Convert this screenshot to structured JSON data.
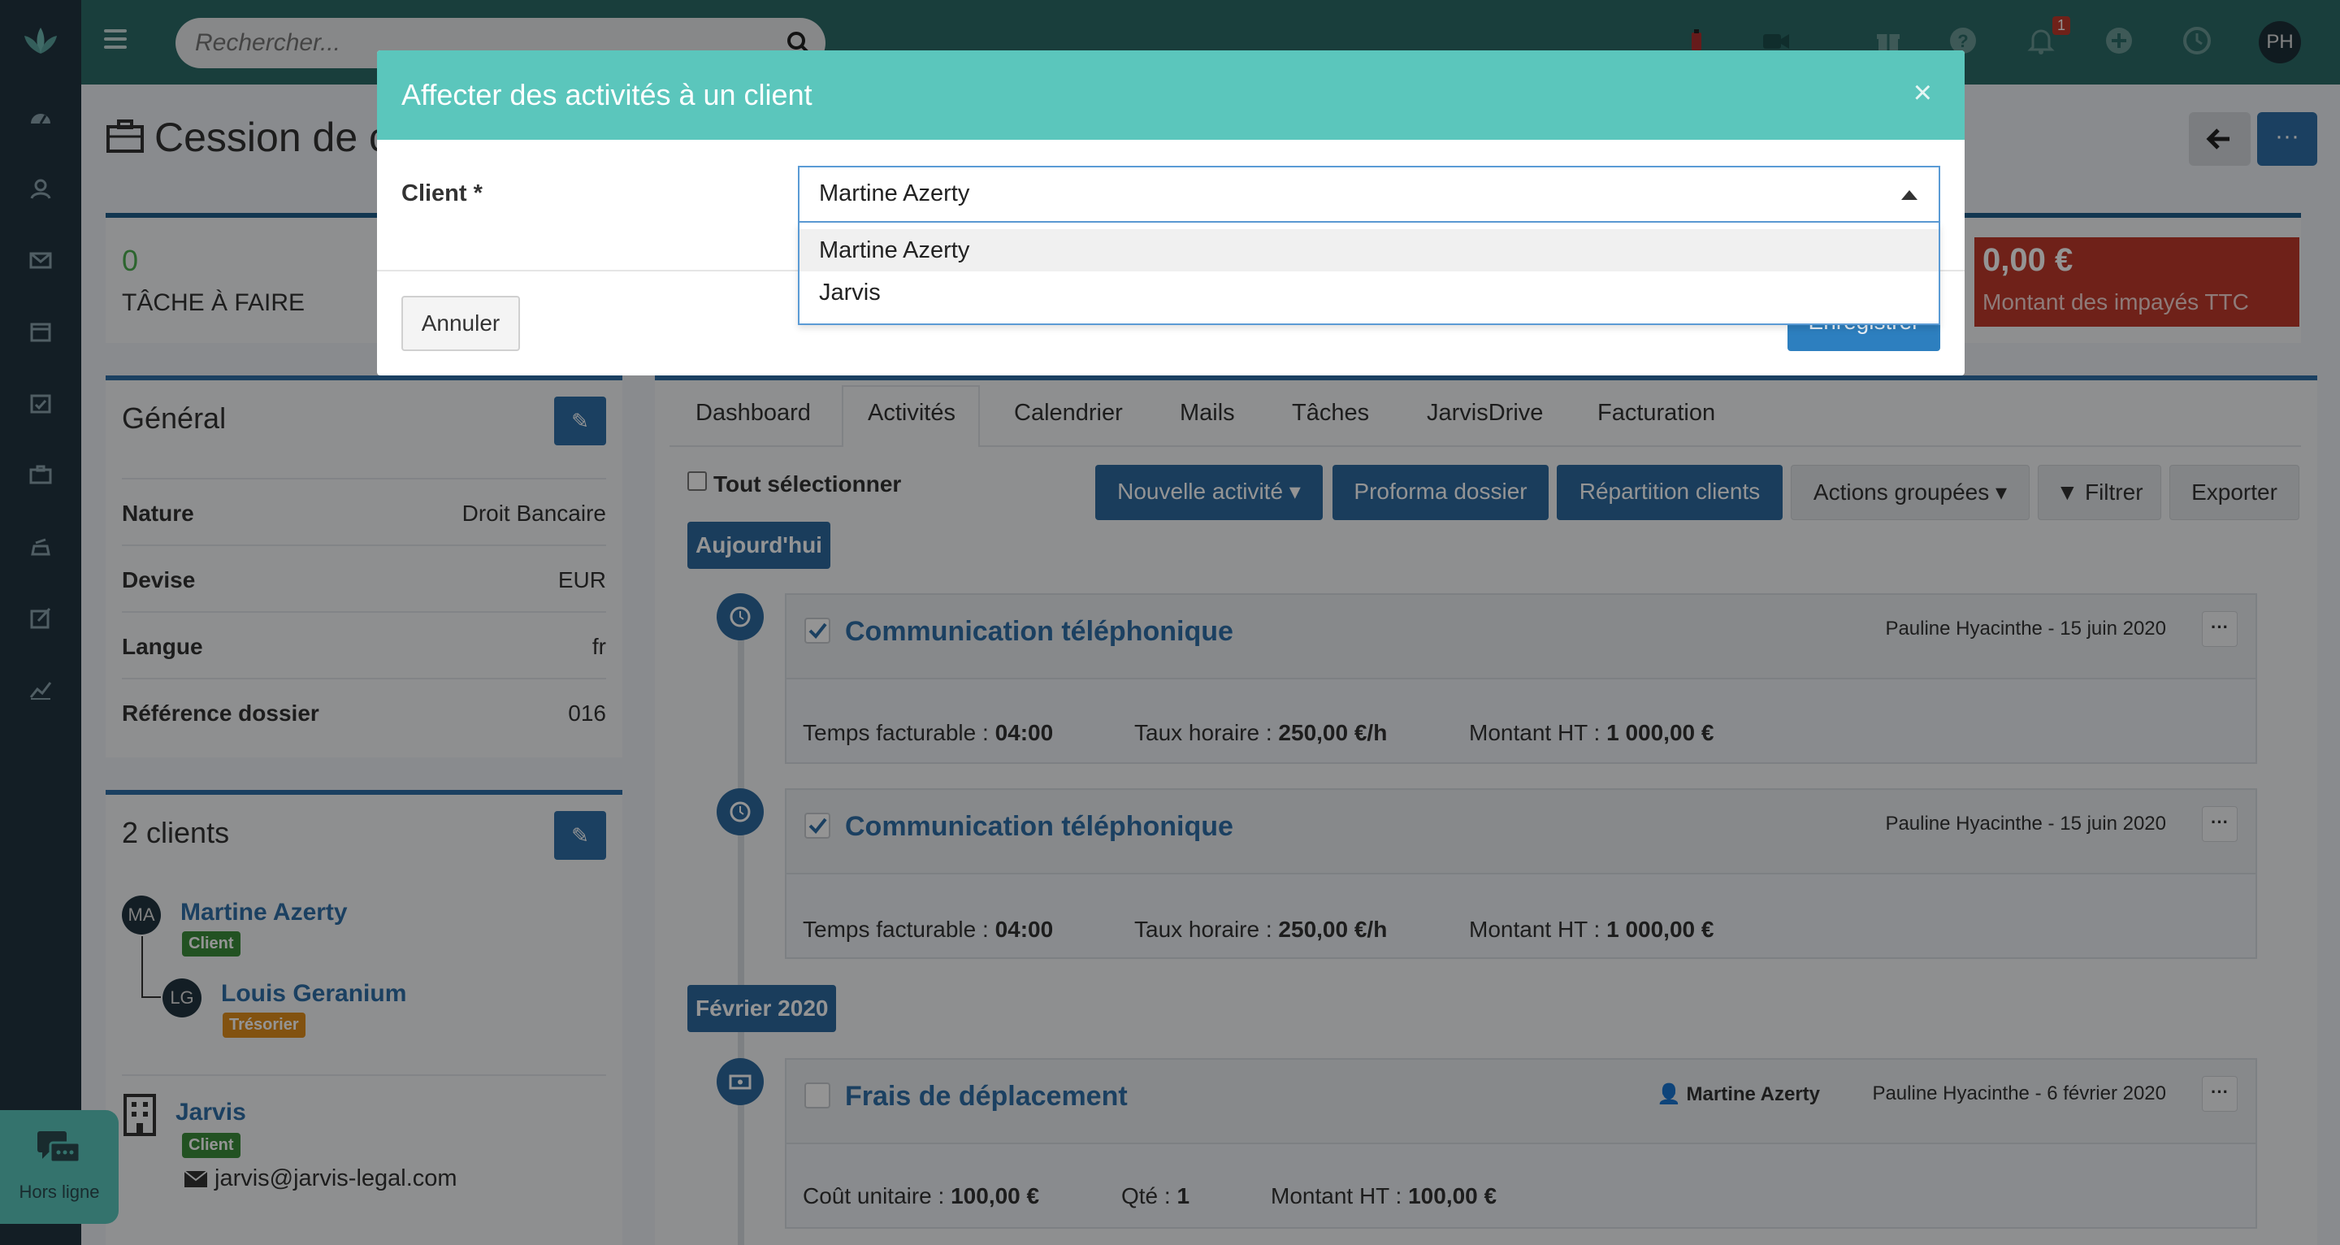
{
  "topbar": {
    "search_placeholder": "Rechercher...",
    "notification_count": "1",
    "user_initials": "PH"
  },
  "page": {
    "title": "Cession de c"
  },
  "kpis": {
    "tasks_value": "0",
    "tasks_label": "TÂCHE À FAIRE",
    "unpaid_value": "0,00 €",
    "unpaid_label": "Montant des impayés TTC"
  },
  "general": {
    "title": "Général",
    "rows": [
      {
        "key": "Nature",
        "value": "Droit Bancaire"
      },
      {
        "key": "Devise",
        "value": "EUR"
      },
      {
        "key": "Langue",
        "value": "fr"
      },
      {
        "key": "Référence dossier",
        "value": "016"
      }
    ]
  },
  "clients": {
    "title": "2 clients",
    "items": [
      {
        "initials": "MA",
        "name": "Martine Azerty",
        "tag": "Client"
      },
      {
        "initials": "LG",
        "name": "Louis Geranium",
        "tag": "Trésorier"
      },
      {
        "name": "Jarvis",
        "tag": "Client",
        "email": "jarvis@jarvis-legal.com"
      }
    ]
  },
  "tabs": [
    "Dashboard",
    "Activités",
    "Calendrier",
    "Mails",
    "Tâches",
    "JarvisDrive",
    "Facturation"
  ],
  "toolbar": {
    "select_all": "Tout sélectionner",
    "new_activity": "Nouvelle activité",
    "proforma": "Proforma dossier",
    "repartition": "Répartition clients",
    "group_actions": "Actions groupées",
    "filter": "Filtrer",
    "export": "Exporter"
  },
  "groups": [
    {
      "label": "Aujourd'hui",
      "activities": [
        {
          "title": "Communication téléphonique",
          "meta": "Pauline Hyacinthe - 15 juin 2020",
          "line": [
            {
              "label": "Temps facturable : ",
              "value": "04:00"
            },
            {
              "label": "Taux horaire : ",
              "value": "250,00 €/h"
            },
            {
              "label": "Montant HT : ",
              "value": "1 000,00 €"
            }
          ]
        },
        {
          "title": "Communication téléphonique",
          "meta": "Pauline Hyacinthe - 15 juin 2020",
          "line": [
            {
              "label": "Temps facturable : ",
              "value": "04:00"
            },
            {
              "label": "Taux horaire : ",
              "value": "250,00 €/h"
            },
            {
              "label": "Montant HT : ",
              "value": "1 000,00 €"
            }
          ]
        }
      ]
    },
    {
      "label": "Février 2020",
      "activities": [
        {
          "title": "Frais de déplacement",
          "client": "Martine Azerty",
          "meta": "Pauline Hyacinthe - 6 février 2020",
          "line": [
            {
              "label": "Coût unitaire : ",
              "value": "100,00 €"
            },
            {
              "label": "Qté : ",
              "value": "1"
            },
            {
              "label": "Montant HT : ",
              "value": "100,00 €"
            }
          ]
        }
      ]
    }
  ],
  "modal": {
    "title": "Affecter des activités à un client",
    "close": "×",
    "client_label": "Client *",
    "client_value": "Martine Azerty",
    "options": [
      "Martine Azerty",
      "Jarvis"
    ],
    "cancel": "Annuler",
    "save": "Enregistrer"
  },
  "chat": {
    "status": "Hors ligne"
  },
  "colors": {
    "sidebar": "#223540",
    "topbar": "#2c6c68",
    "accent": "#5bc6bc",
    "primary": "#2d6a9f",
    "danger": "#c0392b"
  }
}
